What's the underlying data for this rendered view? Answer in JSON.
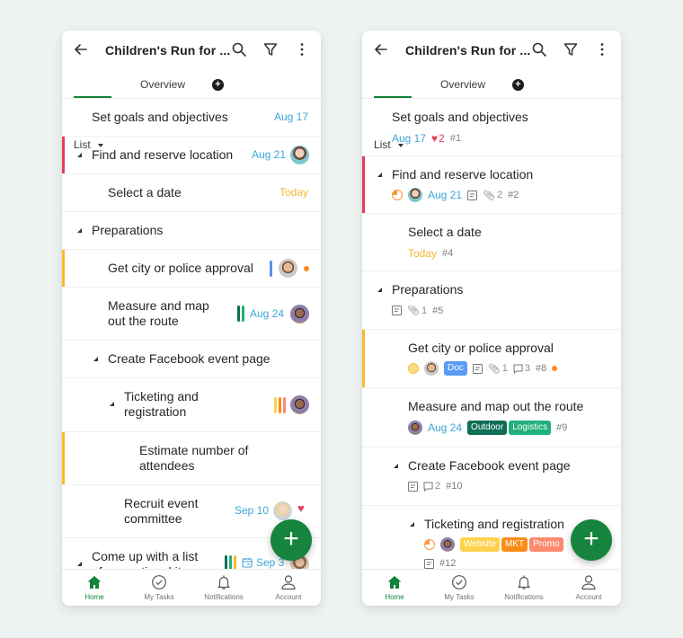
{
  "appbar": {
    "title": "Children's Run for ...",
    "back_icon": "arrow-left-icon",
    "search_icon": "search-icon",
    "filter_icon": "filter-icon",
    "more_icon": "more-vertical-icon"
  },
  "tabs": {
    "list_label": "List",
    "overview_label": "Overview",
    "add_icon": "plus-circle-icon"
  },
  "colors": {
    "brand_green": "#14833b",
    "date_blue": "#3ba7d6",
    "today_yellow": "#f5b731",
    "accent_red": "#e53e5a",
    "accent_yellow": "#f8bb2c"
  },
  "compact_list": {
    "rows": [
      {
        "name": "Set goals and objectives",
        "date": "Aug 17"
      },
      {
        "name": "Find and reserve location",
        "date": "Aug 21"
      },
      {
        "name": "Select a date",
        "date": "Today"
      },
      {
        "name": "Preparations"
      },
      {
        "name": "Get city or police approval"
      },
      {
        "name_line1": "Measure and map",
        "name_line2": "out the route",
        "date": "Aug 24"
      },
      {
        "name": "Create Facebook event page"
      },
      {
        "name_line1": "Ticketing and",
        "name_line2": "registration"
      },
      {
        "name_line1": "Estimate number of",
        "name_line2": "attendees"
      },
      {
        "name_line1": "Recruit event",
        "name_line2": "committee",
        "date": "Sep 10"
      },
      {
        "name_line1": "Come up with a list",
        "name_line2": "of promotional items",
        "date": "Sep 3"
      }
    ]
  },
  "detailed_list": {
    "rows": [
      {
        "name": "Set goals and objectives",
        "date": "Aug 17",
        "likes": "2",
        "id": "#1"
      },
      {
        "name": "Find and reserve location",
        "date": "Aug 21",
        "attachments": "2",
        "id": "#2"
      },
      {
        "name": "Select a date",
        "date": "Today",
        "id": "#4"
      },
      {
        "name": "Preparations",
        "attachments": "1",
        "id": "#5"
      },
      {
        "name": "Get city or police approval",
        "tag": "Doc",
        "attachments": "1",
        "comments": "3",
        "id": "#8"
      },
      {
        "name": "Measure and map out the route",
        "date": "Aug 24",
        "tags": [
          "Outdoor",
          "Logistics"
        ],
        "id": "#9"
      },
      {
        "name": "Create Facebook event page",
        "comments": "2",
        "id": "#10"
      },
      {
        "name": "Ticketing and registration",
        "tags": [
          "Website",
          "MKT",
          "Promo"
        ],
        "id": "#12"
      }
    ]
  },
  "fab": {
    "label": "+"
  },
  "bottom_nav": [
    {
      "label": "Home",
      "icon": "home-icon",
      "active": true
    },
    {
      "label": "My Tasks",
      "icon": "check-circle-icon"
    },
    {
      "label": "Notifications",
      "icon": "bell-icon"
    },
    {
      "label": "Account",
      "icon": "user-icon"
    }
  ]
}
